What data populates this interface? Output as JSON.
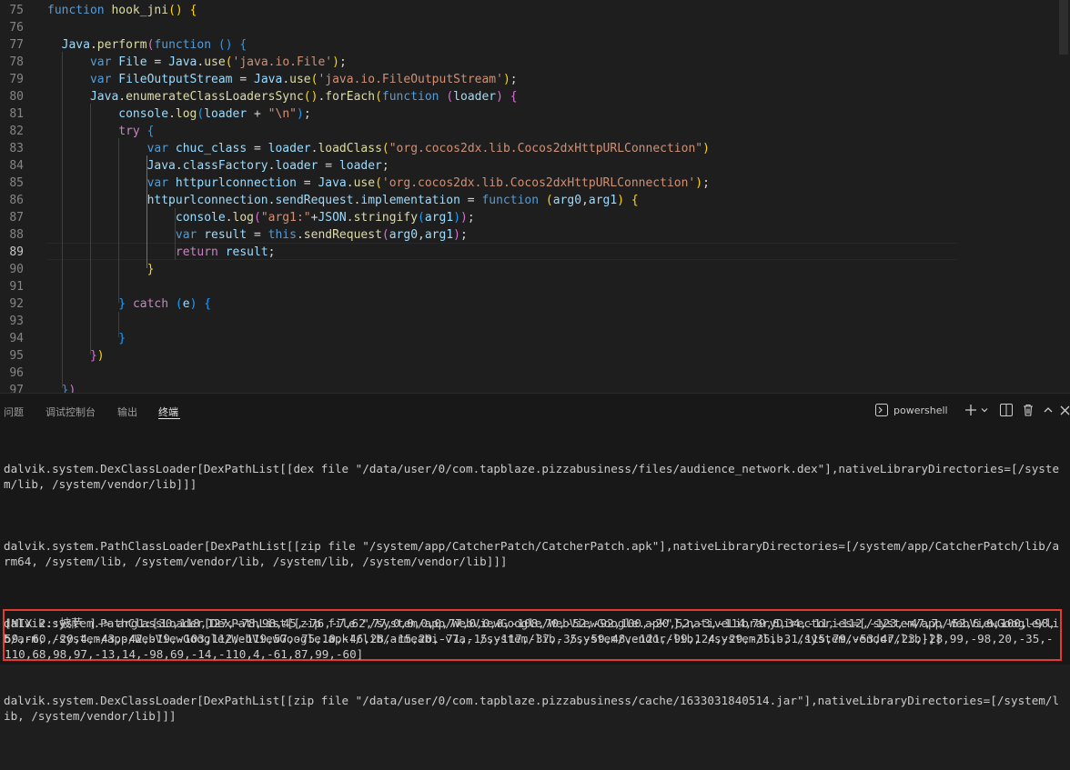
{
  "editor": {
    "active_line": "89",
    "lines": [
      {
        "n": "75",
        "tokens": [
          [
            "kw",
            "function"
          ],
          [
            "plain",
            " "
          ],
          [
            "fn",
            "hook_jni"
          ],
          [
            "b1",
            "()"
          ],
          [
            "plain",
            " "
          ],
          [
            "b1",
            "{"
          ]
        ]
      },
      {
        "n": "76",
        "tokens": []
      },
      {
        "n": "77",
        "tokens": [
          [
            "plain",
            "  "
          ],
          [
            "var",
            "Java"
          ],
          [
            "plain",
            "."
          ],
          [
            "fn",
            "perform"
          ],
          [
            "b2",
            "("
          ],
          [
            "kw",
            "function"
          ],
          [
            "plain",
            " "
          ],
          [
            "b3",
            "()"
          ],
          [
            "plain",
            " "
          ],
          [
            "b3",
            "{"
          ]
        ]
      },
      {
        "n": "78",
        "tokens": [
          [
            "plain",
            "      "
          ],
          [
            "kw",
            "var"
          ],
          [
            "plain",
            " "
          ],
          [
            "var",
            "File"
          ],
          [
            "plain",
            " = "
          ],
          [
            "var",
            "Java"
          ],
          [
            "plain",
            "."
          ],
          [
            "fn",
            "use"
          ],
          [
            "b1",
            "("
          ],
          [
            "str",
            "'java.io.File'"
          ],
          [
            "b1",
            ")"
          ],
          [
            "plain",
            ";"
          ]
        ]
      },
      {
        "n": "79",
        "tokens": [
          [
            "plain",
            "      "
          ],
          [
            "kw",
            "var"
          ],
          [
            "plain",
            " "
          ],
          [
            "var",
            "FileOutputStream"
          ],
          [
            "plain",
            " = "
          ],
          [
            "var",
            "Java"
          ],
          [
            "plain",
            "."
          ],
          [
            "fn",
            "use"
          ],
          [
            "b1",
            "("
          ],
          [
            "str",
            "'java.io.FileOutputStream'"
          ],
          [
            "b1",
            ")"
          ],
          [
            "plain",
            ";"
          ]
        ]
      },
      {
        "n": "80",
        "tokens": [
          [
            "plain",
            "      "
          ],
          [
            "var",
            "Java"
          ],
          [
            "plain",
            "."
          ],
          [
            "fn",
            "enumerateClassLoadersSync"
          ],
          [
            "b1",
            "()"
          ],
          [
            "plain",
            "."
          ],
          [
            "fn",
            "forEach"
          ],
          [
            "b1",
            "("
          ],
          [
            "kw",
            "function"
          ],
          [
            "plain",
            " "
          ],
          [
            "b2",
            "("
          ],
          [
            "var",
            "loader"
          ],
          [
            "b2",
            ")"
          ],
          [
            "plain",
            " "
          ],
          [
            "b2",
            "{"
          ]
        ]
      },
      {
        "n": "81",
        "tokens": [
          [
            "plain",
            "          "
          ],
          [
            "var",
            "console"
          ],
          [
            "plain",
            "."
          ],
          [
            "fn",
            "log"
          ],
          [
            "b3",
            "("
          ],
          [
            "var",
            "loader"
          ],
          [
            "plain",
            " + "
          ],
          [
            "str",
            "\"\\n\""
          ],
          [
            "b3",
            ")"
          ],
          [
            "plain",
            ";"
          ]
        ]
      },
      {
        "n": "82",
        "tokens": [
          [
            "plain",
            "          "
          ],
          [
            "ctl",
            "try"
          ],
          [
            "plain",
            " "
          ],
          [
            "b3",
            "{"
          ]
        ]
      },
      {
        "n": "83",
        "tokens": [
          [
            "plain",
            "              "
          ],
          [
            "kw",
            "var"
          ],
          [
            "plain",
            " "
          ],
          [
            "var",
            "chuc_class"
          ],
          [
            "plain",
            " = "
          ],
          [
            "var",
            "loader"
          ],
          [
            "plain",
            "."
          ],
          [
            "fn",
            "loadClass"
          ],
          [
            "b1",
            "("
          ],
          [
            "str",
            "\"org.cocos2dx.lib.Cocos2dxHttpURLConnection\""
          ],
          [
            "b1",
            ")"
          ]
        ]
      },
      {
        "n": "84",
        "tokens": [
          [
            "plain",
            "              "
          ],
          [
            "var",
            "Java"
          ],
          [
            "plain",
            "."
          ],
          [
            "var",
            "classFactory"
          ],
          [
            "plain",
            "."
          ],
          [
            "var",
            "loader"
          ],
          [
            "plain",
            " = "
          ],
          [
            "var",
            "loader"
          ],
          [
            "plain",
            ";"
          ]
        ]
      },
      {
        "n": "85",
        "tokens": [
          [
            "plain",
            "              "
          ],
          [
            "kw",
            "var"
          ],
          [
            "plain",
            " "
          ],
          [
            "var",
            "httpurlconnection"
          ],
          [
            "plain",
            " = "
          ],
          [
            "var",
            "Java"
          ],
          [
            "plain",
            "."
          ],
          [
            "fn",
            "use"
          ],
          [
            "b1",
            "("
          ],
          [
            "str",
            "'org.cocos2dx.lib.Cocos2dxHttpURLConnection'"
          ],
          [
            "b1",
            ")"
          ],
          [
            "plain",
            ";"
          ]
        ]
      },
      {
        "n": "86",
        "tokens": [
          [
            "plain",
            "              "
          ],
          [
            "var",
            "httpurlconnection"
          ],
          [
            "plain",
            "."
          ],
          [
            "var",
            "sendRequest"
          ],
          [
            "plain",
            "."
          ],
          [
            "var",
            "implementation"
          ],
          [
            "plain",
            " = "
          ],
          [
            "kw",
            "function"
          ],
          [
            "plain",
            " "
          ],
          [
            "b1",
            "("
          ],
          [
            "var",
            "arg0"
          ],
          [
            "plain",
            ","
          ],
          [
            "var",
            "arg1"
          ],
          [
            "b1",
            ")"
          ],
          [
            "plain",
            " "
          ],
          [
            "b1",
            "{"
          ]
        ]
      },
      {
        "n": "87",
        "tokens": [
          [
            "plain",
            "                  "
          ],
          [
            "var",
            "console"
          ],
          [
            "plain",
            "."
          ],
          [
            "fn",
            "log"
          ],
          [
            "b2",
            "("
          ],
          [
            "str",
            "\"arg1:\""
          ],
          [
            "plain",
            "+"
          ],
          [
            "var",
            "JSON"
          ],
          [
            "plain",
            "."
          ],
          [
            "fn",
            "stringify"
          ],
          [
            "b3",
            "("
          ],
          [
            "var",
            "arg1"
          ],
          [
            "b3",
            ")"
          ],
          [
            "b2",
            ")"
          ],
          [
            "plain",
            ";"
          ]
        ]
      },
      {
        "n": "88",
        "tokens": [
          [
            "plain",
            "                  "
          ],
          [
            "kw",
            "var"
          ],
          [
            "plain",
            " "
          ],
          [
            "var",
            "result"
          ],
          [
            "plain",
            " = "
          ],
          [
            "kw",
            "this"
          ],
          [
            "plain",
            "."
          ],
          [
            "fn",
            "sendRequest"
          ],
          [
            "b2",
            "("
          ],
          [
            "var",
            "arg0"
          ],
          [
            "plain",
            ","
          ],
          [
            "var",
            "arg1"
          ],
          [
            "b2",
            ")"
          ],
          [
            "plain",
            ";"
          ]
        ]
      },
      {
        "n": "89",
        "tokens": [
          [
            "plain",
            "                  "
          ],
          [
            "ctl",
            "return"
          ],
          [
            "plain",
            " "
          ],
          [
            "var",
            "result"
          ],
          [
            "plain",
            ";"
          ]
        ]
      },
      {
        "n": "90",
        "tokens": [
          [
            "plain",
            "              "
          ],
          [
            "b1",
            "}"
          ]
        ]
      },
      {
        "n": "91",
        "tokens": []
      },
      {
        "n": "92",
        "tokens": [
          [
            "plain",
            "          "
          ],
          [
            "b3",
            "}"
          ],
          [
            "plain",
            " "
          ],
          [
            "ctl",
            "catch"
          ],
          [
            "plain",
            " "
          ],
          [
            "b3",
            "("
          ],
          [
            "var",
            "e"
          ],
          [
            "b3",
            ")"
          ],
          [
            "plain",
            " "
          ],
          [
            "b3",
            "{"
          ]
        ]
      },
      {
        "n": "93",
        "tokens": []
      },
      {
        "n": "94",
        "tokens": [
          [
            "plain",
            "          "
          ],
          [
            "b3",
            "}"
          ]
        ]
      },
      {
        "n": "95",
        "tokens": [
          [
            "plain",
            "      "
          ],
          [
            "b2",
            "}"
          ],
          [
            "b1",
            ")"
          ]
        ]
      },
      {
        "n": "96",
        "tokens": []
      },
      {
        "n": "97",
        "tokens": [
          [
            "plain",
            "  "
          ],
          [
            "b3",
            "}"
          ],
          [
            "b2",
            ")"
          ]
        ]
      }
    ]
  },
  "panel": {
    "tabs": [
      "问题",
      "调试控制台",
      "输出",
      "终端"
    ],
    "active_tab": "终端",
    "terminal_profile": "powershell",
    "output_blocks": [
      "dalvik.system.DexClassLoader[DexPathList[[dex file \"/data/user/0/com.tapblaze.pizzabusiness/files/audience_network.dex\"],nativeLibraryDirectories=[/system/lib, /system/vendor/lib]]]",
      "dalvik.system.PathClassLoader[DexPathList[[zip file \"/system/app/CatcherPatch/CatcherPatch.apk\"],nativeLibraryDirectories=[/system/app/CatcherPatch/lib/arm64, /system/lib, /system/vendor/lib, /system/lib, /system/vendor/lib]]]",
      "dalvik.system.PathClassLoader[DexPathList[[zip file \"/system/app/WebViewGoogle/WebViewGoogle.apk\"],nativeLibraryDirectories=[/system/app/WebViewGoogle/lib/arm, /system/app/WebViewGoogle/WebViewGoogle.apk!/lib/armeabi-v7a, /system/lib, /system/vendor/lib, /system/lib, /system/vendor/lib]]]",
      "dalvik.system.DexClassLoader[DexPathList[[zip file \"/data/user/0/com.tapblaze.pizzabusiness/cache/1633031840514.jar\"],nativeLibraryDirectories=[/system/lib, /system/vendor/lib]]]"
    ],
    "highlighted_output": "[MIX 2::披萨 ]-> arg1:[30,118,127,-78,98,45,-76,-7,62,77,0,0,0,0,77,0,0,0,-108,70,-52,-92,100,-20,52,-3,-114,79,6,34,-11,-112,-123,-47,7,-52,6,0,100,-98,59,-60,-20,4,-43,-42,-19,-103,112,-119,57,-75,10,-46,28,-15,20,-71,-15,-117,-37,-35,-59,48,-121,-99,124,-29,-35,-31,115,79,-53,47,23,-28,99,-98,20,-35,-110,68,98,97,-13,14,-98,69,-14,-110,4,-61,87,99,-60]",
    "highlight_color": "#e03c31"
  }
}
